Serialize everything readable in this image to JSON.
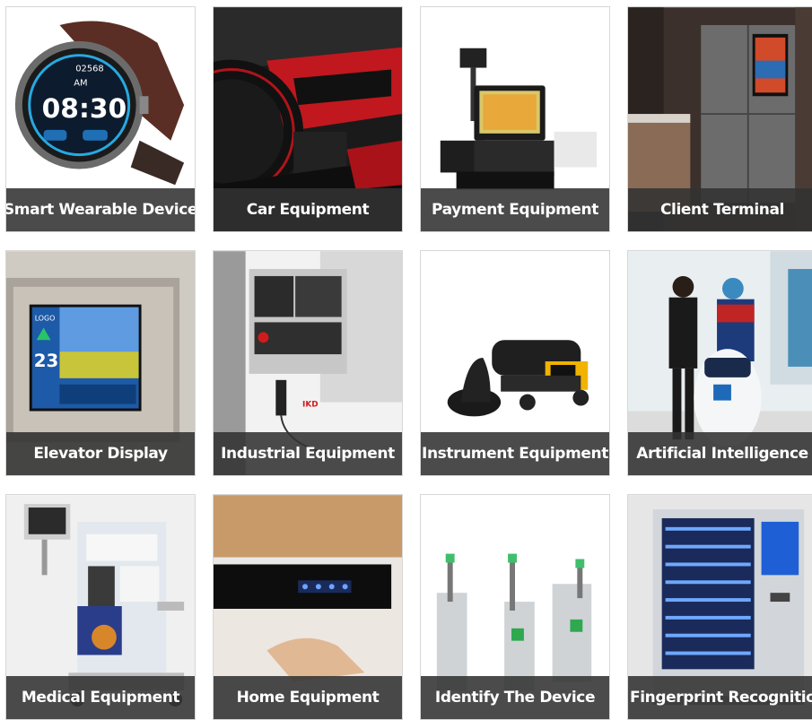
{
  "grid": {
    "tiles": [
      {
        "label": "Smart Wearable Device",
        "icon": "smartwatch-image",
        "watch_time": "08:30",
        "watch_steps": "02568",
        "watch_day": "AM"
      },
      {
        "label": "Car Equipment",
        "icon": "car-interior-image"
      },
      {
        "label": "Payment Equipment",
        "icon": "pos-terminal-image"
      },
      {
        "label": "Client Terminal",
        "icon": "smart-fridge-image"
      },
      {
        "label": "Elevator Display",
        "icon": "elevator-screen-image",
        "screen_logo": "LOGO",
        "screen_floor": "23"
      },
      {
        "label": "Industrial Equipment",
        "icon": "cnc-panel-image"
      },
      {
        "label": "Instrument Equipment",
        "icon": "scanner-instrument-image"
      },
      {
        "label": "Artificial Intelligence",
        "icon": "service-robot-image"
      },
      {
        "label": "Medical Equipment",
        "icon": "anesthesia-machine-image"
      },
      {
        "label": "Home Equipment",
        "icon": "range-hood-image"
      },
      {
        "label": "Identify The Device",
        "icon": "turnstile-gates-image"
      },
      {
        "label": "Fingerprint Recognition",
        "icon": "vending-machine-image"
      }
    ]
  }
}
